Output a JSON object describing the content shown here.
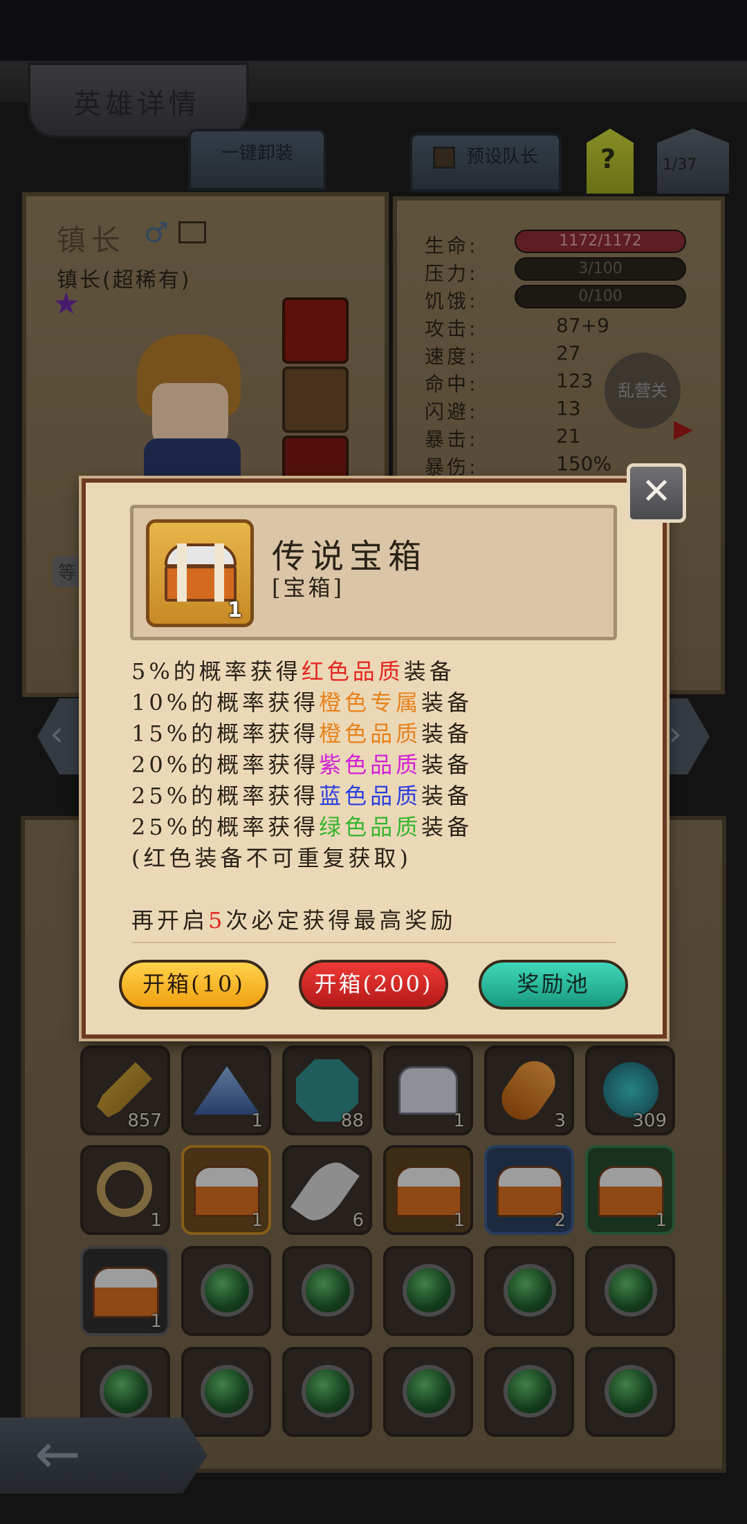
{
  "screen": {
    "title": "英雄详情",
    "unequip_all": "一键卸装",
    "preset_captain": "预设队长",
    "help": "?",
    "page_counter": "1/37"
  },
  "hero": {
    "name": "镇长",
    "subtitle": "镇长(超稀有)",
    "tag_short": "等"
  },
  "stats": [
    {
      "label": "生命:",
      "value": "1172/1172",
      "kind": "bar",
      "color": "#8b2b34"
    },
    {
      "label": "压力:",
      "value": "3/100",
      "kind": "bar",
      "color": "#2a2520"
    },
    {
      "label": "饥饿:",
      "value": "0/100",
      "kind": "bar",
      "color": "#2a2520"
    },
    {
      "label": "攻击:",
      "value": "87+9",
      "kind": "text"
    },
    {
      "label": "速度:",
      "value": "27",
      "kind": "text"
    },
    {
      "label": "命中:",
      "value": "123",
      "kind": "text"
    },
    {
      "label": "闪避:",
      "value": "13",
      "kind": "text"
    },
    {
      "label": "暴击:",
      "value": "21",
      "kind": "text"
    },
    {
      "label": "暴伤:",
      "value": "150%",
      "kind": "text"
    }
  ],
  "hidden_badge": "乱营关",
  "inventory": {
    "row1": [
      "857",
      "1",
      "88",
      "1",
      "3",
      "309"
    ],
    "row2": [
      "1",
      "1",
      "6",
      "1",
      "2",
      "1"
    ],
    "row3": [
      "1",
      "",
      "",
      "",
      "",
      ""
    ]
  },
  "dialog": {
    "item_name": "传说宝箱",
    "item_type": "[宝箱]",
    "item_qty": "1",
    "odds": [
      {
        "pre": "5%的概率获得",
        "hl": "红色品质",
        "post": "装备",
        "color": "#e4251e"
      },
      {
        "pre": "10%的概率获得",
        "hl": "橙色专属",
        "post": "装备",
        "color": "#e8821c"
      },
      {
        "pre": "15%的概率获得",
        "hl": "橙色品质",
        "post": "装备",
        "color": "#e8821c"
      },
      {
        "pre": "20%的概率获得",
        "hl": "紫色品质",
        "post": "装备",
        "color": "#d21fd6"
      },
      {
        "pre": "25%的概率获得",
        "hl": "蓝色品质",
        "post": "装备",
        "color": "#2a3ee0"
      },
      {
        "pre": "25%的概率获得",
        "hl": "绿色品质",
        "post": "装备",
        "color": "#35b52c"
      }
    ],
    "note": "(红色装备不可重复获取)",
    "guarantee_pre": "再开启",
    "guarantee_num": "5",
    "guarantee_post": "次必定获得最高奖励",
    "btn_open10": "开箱(10)",
    "btn_open200": "开箱(200)",
    "btn_pool": "奖励池",
    "close_icon": "close-x-icon"
  }
}
